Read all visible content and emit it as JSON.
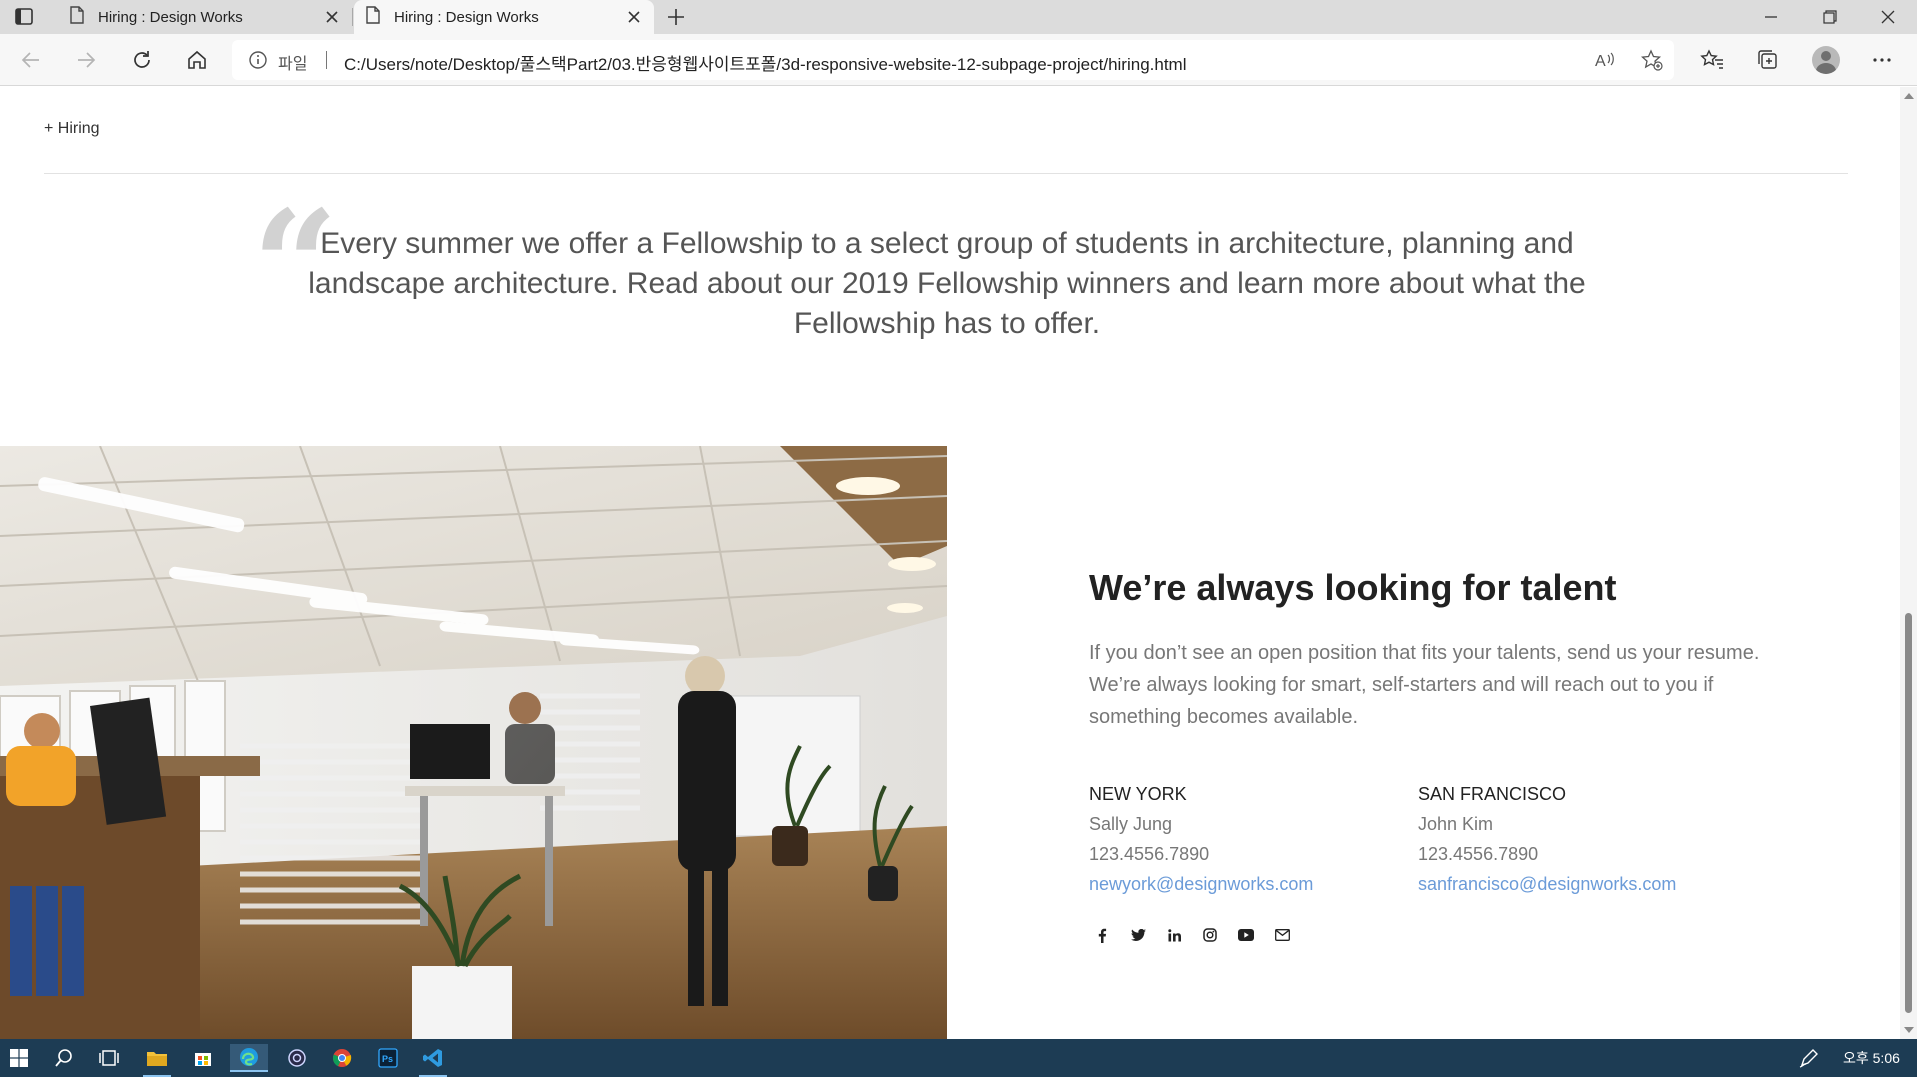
{
  "browser": {
    "tabs": [
      {
        "title": "Hiring : Design Works",
        "active": false
      },
      {
        "title": "Hiring : Design Works",
        "active": true
      }
    ],
    "address_file_label": "파일",
    "url": "C:/Users/note/Desktop/풀스택Part2/03.반응형웹사이트포폴/3d-responsive-website-12-subpage-project/hiring.html"
  },
  "page": {
    "breadcrumb": "+ Hiring",
    "quote": "Every summer we offer a Fellowship to a select group of students in architecture, planning and landscape architecture. Read about our 2019 Fellowship winners and learn more about what the Fellowship has to offer.",
    "talent": {
      "title": "We’re always looking for talent",
      "description": "If you don’t see an open position that fits your talents, send us your resume. We’re always looking for smart, self-starters and will reach out to you if something becomes available."
    },
    "contacts": [
      {
        "city": "NEW YORK",
        "name": "Sally Jung",
        "phone": "123.4556.7890",
        "email": "newyork@designworks.com"
      },
      {
        "city": "SAN FRANCISCO",
        "name": "John Kim",
        "phone": "123.4556.7890",
        "email": "sanfrancisco@designworks.com"
      }
    ],
    "social": [
      "facebook-icon",
      "twitter-icon",
      "linkedin-icon",
      "instagram-icon",
      "youtube-icon",
      "envelope-icon"
    ]
  },
  "taskbar": {
    "clock": "오후 5:06",
    "apps": [
      "windows-start-icon",
      "search-icon",
      "task-view-icon",
      "file-explorer-icon",
      "store-icon",
      "edge-icon",
      "app-icon",
      "chrome-icon",
      "photoshop-icon",
      "vscode-icon"
    ]
  },
  "colors": {
    "accent_link": "#6b9bd8",
    "taskbar": "#1d3c54",
    "tab_strip": "#dcdcdc"
  }
}
